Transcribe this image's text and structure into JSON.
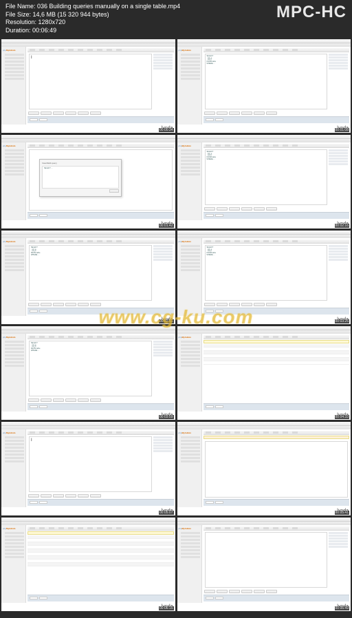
{
  "app": {
    "title": "MPC-HC"
  },
  "file": {
    "name_label": "File Name:",
    "name": "036 Building queries manually on a single table.mp4",
    "size_label": "File Size:",
    "size": "14,6 MB (15 320 944 bytes)",
    "res_label": "Resolution:",
    "res": "1280x720",
    "dur_label": "Duration:",
    "dur": "00:06:49"
  },
  "logo": {
    "php": "php",
    "myadmin": "MyAdmin"
  },
  "brand": "lynda",
  "watermark": "www.cg-ku.com",
  "thumbs": [
    {
      "ts": "00:00:34",
      "variant": "blank"
    },
    {
      "ts": "00:01:08",
      "variant": "query"
    },
    {
      "ts": "00:01:42",
      "variant": "modal"
    },
    {
      "ts": "00:02:16",
      "variant": "query2"
    },
    {
      "ts": "00:02:51",
      "variant": "query2"
    },
    {
      "ts": "00:03:25",
      "variant": "query2"
    },
    {
      "ts": "00:03:59",
      "variant": "query3"
    },
    {
      "ts": "00:04:33",
      "variant": "result"
    },
    {
      "ts": "00:05:07",
      "variant": "blank"
    },
    {
      "ts": "00:05:41",
      "variant": "error"
    },
    {
      "ts": "00:06:15",
      "variant": "table"
    },
    {
      "ts": "00:06:49",
      "variant": "blank2"
    }
  ],
  "modal": {
    "title": "Insert/Edit query"
  }
}
